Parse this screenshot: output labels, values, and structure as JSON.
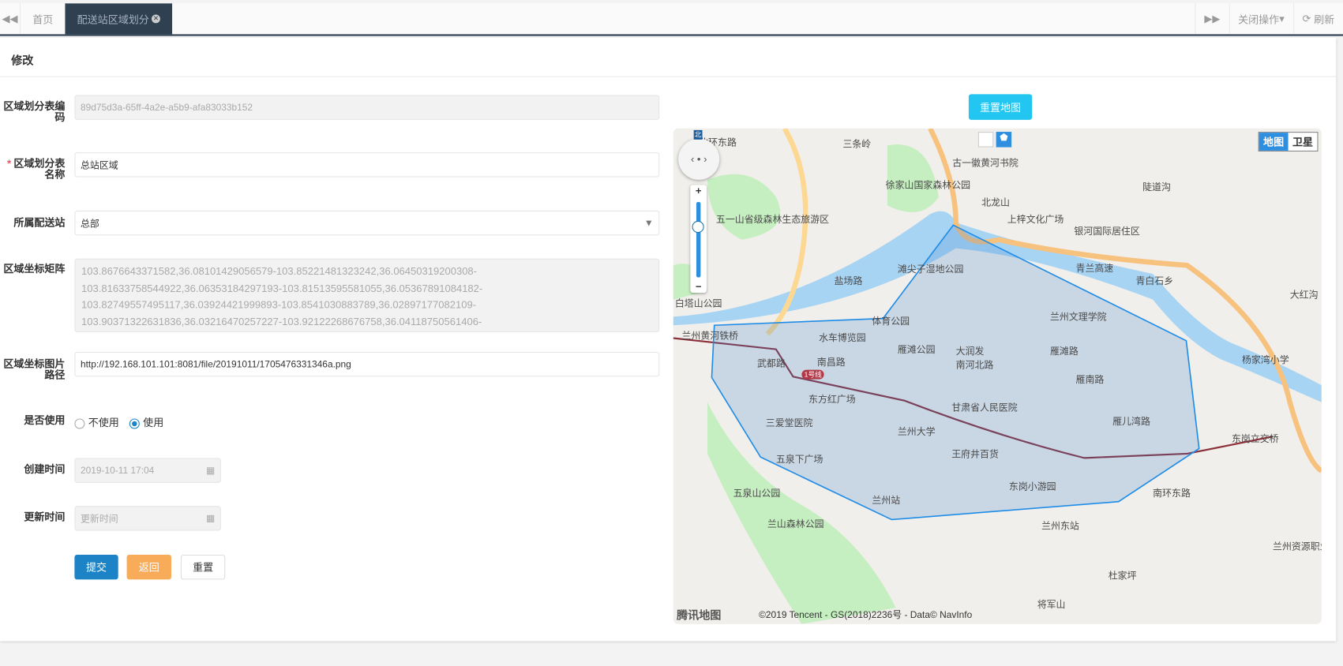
{
  "tabs": {
    "home": "首页",
    "active": "配送站区域划分",
    "close_ops": "关闭操作",
    "refresh": "刷新"
  },
  "panel_title": "修改",
  "form": {
    "code_label": "区域划分表编码",
    "code_value": "89d75d3a-65ff-4a2e-a5b9-afa83033b152",
    "name_label": "区域划分表名称",
    "name_value": "总站区域",
    "station_label": "所属配送站",
    "station_value": "总部",
    "coords_label": "区域坐标矩阵",
    "coords_value": "103.8676643371582,36.08101429056579-103.85221481323242,36.06450319200308-103.81633758544922,36.06353184297193-103.81513595581055,36.05367891084182-103.82749557495117,36.03924421999893-103.8541030883789,36.02897177082109-103.90371322631836,36.03216470257227-103.92122268676758,36.04118750561406-",
    "image_label": "区域坐标图片路径",
    "image_value": "http://192.168.101.101:8081/file/20191011/1705476331346a.png",
    "use_label": "是否使用",
    "use_options": [
      "不使用",
      "使用"
    ],
    "use_selected": "使用",
    "created_label": "创建时间",
    "created_value": "2019-10-11 17:04",
    "updated_label": "更新时间",
    "updated_placeholder": "更新时间",
    "submit": "提交",
    "back": "返回",
    "reset": "重置"
  },
  "map": {
    "reset_button": "重置地图",
    "type_map": "地图",
    "type_satellite": "卫星",
    "north": "北",
    "attribution": "©2019 Tencent - GS(2018)2236号 - Data© NavInfo",
    "logo": "腾讯地图",
    "labels": [
      "三条岭",
      "古一徽黄河书院",
      "徐家山国家森林公园",
      "五一山省级森林生态旅游区",
      "北环东路",
      "北龙山",
      "上梓文化广场",
      "银河国际居住区",
      "陡道沟",
      "盐场路",
      "滩尖子湿地公园",
      "青兰高速",
      "青白石乡",
      "大红沟",
      "白塔山公园",
      "兰州文理学院",
      "体育公园",
      "兰州黄河铁桥",
      "水车博览园",
      "雁滩公园",
      "大润发",
      "雁滩路",
      "杨家湾小学",
      "武都路",
      "南昌路",
      "南河北路",
      "雁南路",
      "东方红广场",
      "甘肃省人民医院",
      "三爱堂医院",
      "兰州大学",
      "雁儿湾路",
      "东岗立交桥",
      "五泉下广场",
      "王府井百货",
      "东岗小游园",
      "五泉山公园",
      "兰州站",
      "南环东路",
      "兰山森林公园",
      "兰州东站",
      "杜家坪",
      "将军山",
      "兰州资源职业技术"
    ],
    "line_label": "1号线",
    "accent": "#1e8ce6"
  },
  "colors": {
    "primary": "#1c84c6",
    "warning": "#f8ac59",
    "map_button": "#23c6f0",
    "tab_dark": "#2f4050"
  }
}
